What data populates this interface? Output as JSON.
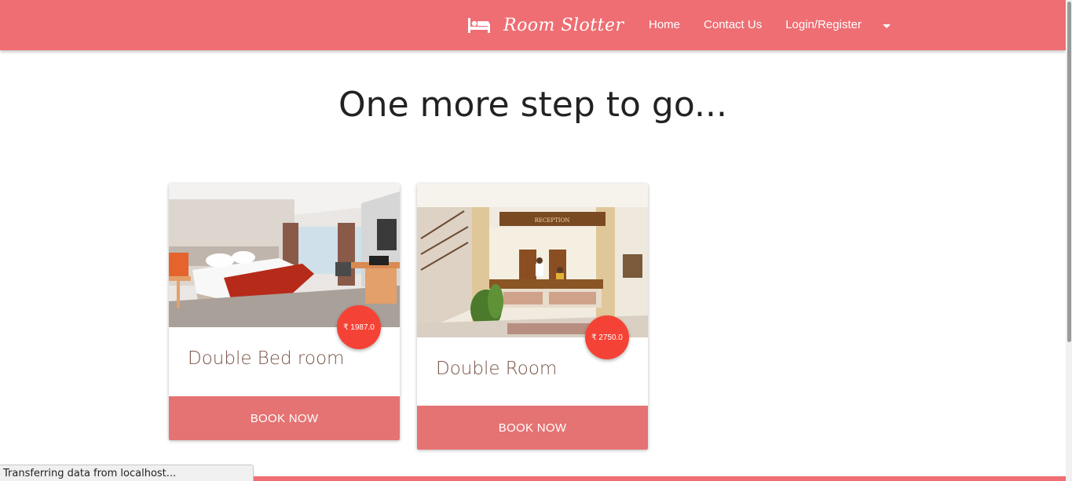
{
  "navbar": {
    "brand_name": "Room Slotter",
    "brand_icon": "bed-icon",
    "links": [
      {
        "label": "Home"
      },
      {
        "label": "Contact Us"
      },
      {
        "label": "Login/Register"
      }
    ],
    "dropdown_icon": "caret-down-icon",
    "color": "#ee6e73"
  },
  "main": {
    "heading": "One more step to go..."
  },
  "rooms": [
    {
      "title": "Double Bed room",
      "price": "₹ 1987.0",
      "button_label": "BOOK NOW"
    },
    {
      "title": "Double Room",
      "price": "₹ 2750.0",
      "button_label": "BOOK NOW"
    }
  ],
  "colors": {
    "accent": "#ee6e73",
    "button": "#e57373",
    "badge": "#f44336",
    "title": "#795548"
  },
  "status_bar": {
    "text": "Transferring data from localhost..."
  }
}
